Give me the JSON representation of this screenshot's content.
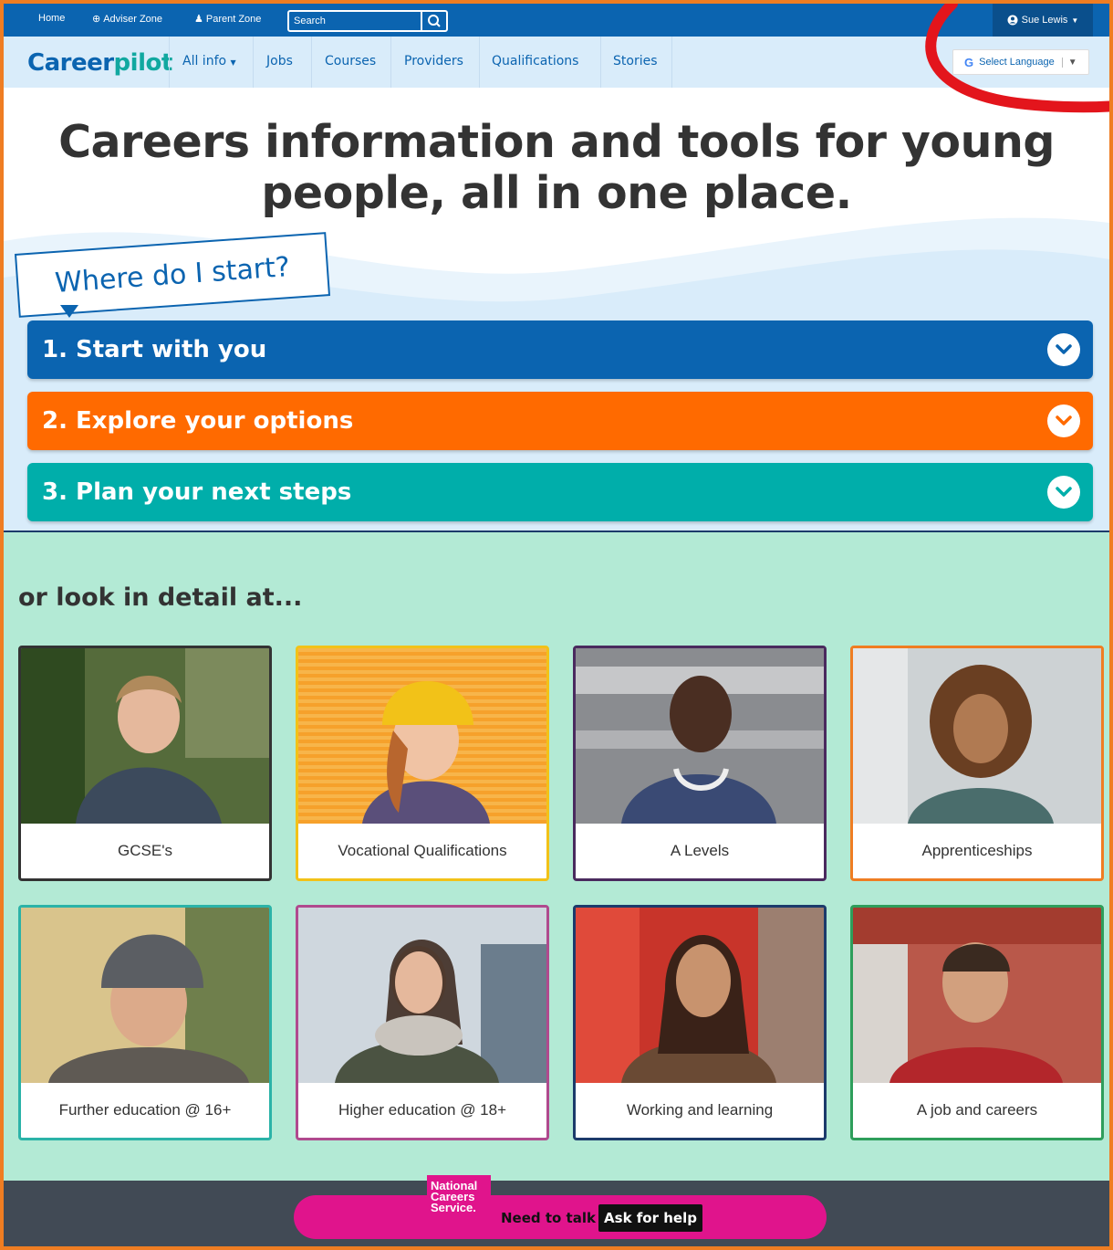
{
  "topbar": {
    "home": "Home",
    "adviser_zone": "Adviser Zone",
    "parent_zone": "Parent Zone",
    "search_placeholder": "Search",
    "user_name": "Sue Lewis"
  },
  "nav": {
    "logo_career": "Career",
    "logo_pilot": "pilot",
    "items": [
      "All info",
      "Jobs",
      "Courses",
      "Providers",
      "Qualifications",
      "Stories"
    ],
    "language": "Select Language"
  },
  "hero": {
    "title_line1": "Careers information and tools for young",
    "title_line2": "people, all in one place.",
    "bubble": "Where do I start?"
  },
  "steps": [
    {
      "label": "1. Start with you",
      "color": "#0b64b0"
    },
    {
      "label": "2. Explore your options",
      "color": "#ff6a00"
    },
    {
      "label": "3. Plan your next steps",
      "color": "#00aeaa"
    }
  ],
  "details": {
    "title": "or look in detail at...",
    "cards": [
      {
        "label": "GCSE's",
        "border": "#333333",
        "icon": "photo-teen-boy"
      },
      {
        "label": "Vocational Qualifications",
        "border": "#f2c218",
        "icon": "photo-yellow-beanie"
      },
      {
        "label": "A Levels",
        "border": "#4a2a5e",
        "icon": "photo-headphones"
      },
      {
        "label": "Apprenticeships",
        "border": "#ef7d22",
        "icon": "photo-curly-hair"
      },
      {
        "label": "Further education @ 16+",
        "border": "#2bb3a8",
        "icon": "photo-grey-beanie"
      },
      {
        "label": "Higher education @ 18+",
        "border": "#b04a8e",
        "icon": "photo-scarf"
      },
      {
        "label": "Working and learning",
        "border": "#1c3b6b",
        "icon": "photo-red-bus"
      },
      {
        "label": "A job and careers",
        "border": "#2e9e5b",
        "icon": "photo-station"
      }
    ]
  },
  "footer": {
    "ncs_line1": "National",
    "ncs_line2": "Careers",
    "ncs_line3": "Service.",
    "need_to_talk": "Need to talk",
    "ask": "Ask for help"
  }
}
